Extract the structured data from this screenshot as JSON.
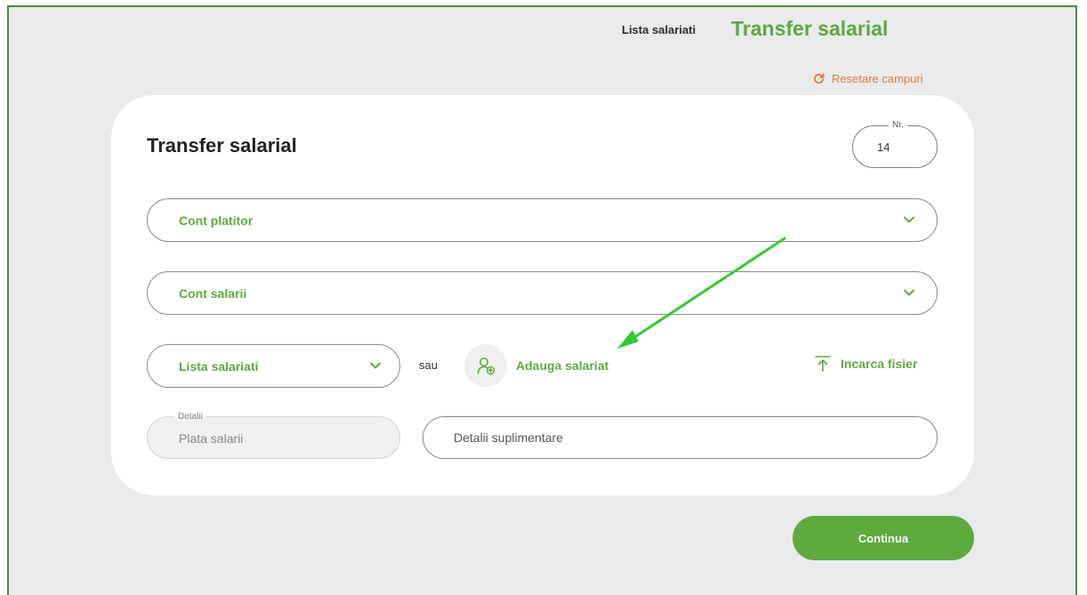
{
  "nav": {
    "link_label": "Lista salariati",
    "active_label": "Transfer salarial"
  },
  "reset": {
    "label": "Resetare campuri",
    "icon": "refresh-icon"
  },
  "form": {
    "title": "Transfer salarial",
    "number": {
      "legend": "Nr.",
      "value": "14"
    },
    "payer_account": {
      "label": "Cont platitor",
      "icon": "chevron-down-icon"
    },
    "salary_account": {
      "label": "Cont salarii",
      "icon": "chevron-down-icon"
    },
    "employee_list": {
      "label": "Lista salariati",
      "icon": "chevron-down-icon"
    },
    "or_text": "sau",
    "add_employee": {
      "label": "Adauga salariat",
      "icon": "add-user-icon"
    },
    "upload_file": {
      "label": "Incarca fisier",
      "icon": "upload-icon"
    },
    "details": {
      "legend": "Detalii",
      "value": "Plata salarii"
    },
    "extra_details": {
      "placeholder": "Detalii suplimentare"
    }
  },
  "continue_label": "Continua",
  "colors": {
    "accent": "#5daa3e",
    "reset": "#ec7a3a",
    "background": "#e9eaec",
    "frame": "#4e8a3a",
    "annotation": "#33cc33"
  }
}
